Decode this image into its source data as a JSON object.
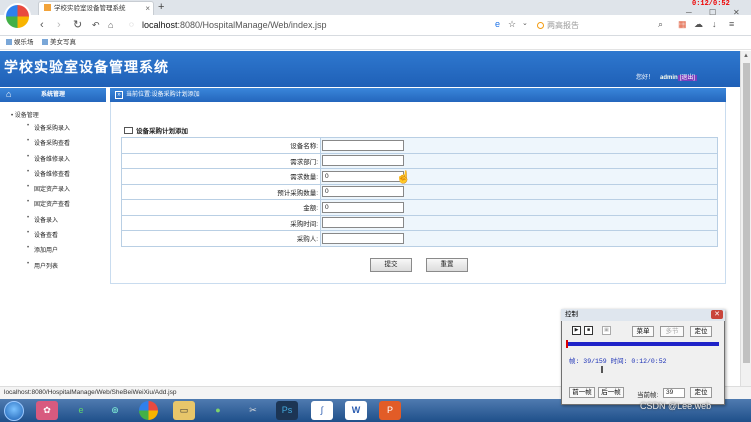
{
  "browser": {
    "tab_title": "学校实验室设备管理系统",
    "tab_close": "×",
    "new_tab": "+",
    "clock": "0:12/0:52",
    "win_min": "─",
    "win_max": "☐",
    "win_close": "✕",
    "url_prefix": "localhost",
    "url_rest": ":8080/HospitalManage/Web/index.jsp",
    "search_placeholder": "两高报告",
    "bookmarks": [
      "娱乐场",
      "美女写真"
    ],
    "status_url": "localhost:8080/HospitalManage/Web/SheBeiWeiXiu/Add.jsp"
  },
  "app": {
    "title": "学校实验室设备管理系统",
    "greeting": "您好！",
    "user": "admin",
    "user_role": "[退出]"
  },
  "sidebar": {
    "header": "系统管理",
    "root": "设备管理",
    "items": [
      {
        "label": "设备采购录入"
      },
      {
        "label": "设备采购查看"
      },
      {
        "label": "设备维修录入"
      },
      {
        "label": "设备维修查看"
      },
      {
        "label": "固定资产录入"
      },
      {
        "label": "固定资产查看"
      },
      {
        "label": "设备录入"
      },
      {
        "label": "设备查看"
      },
      {
        "label": "添加用户"
      },
      {
        "label": "用户列表"
      }
    ]
  },
  "content": {
    "breadcrumb": "当前位置:设备采购计划添加",
    "form_title": "设备采购计划添加",
    "fields": [
      {
        "label": "设备名称:",
        "value": ""
      },
      {
        "label": "需求部门:",
        "value": ""
      },
      {
        "label": "需求数量:",
        "value": "0"
      },
      {
        "label": "预计采购数量:",
        "value": "0"
      },
      {
        "label": "金额:",
        "value": "0"
      },
      {
        "label": "采购时间:",
        "value": ""
      },
      {
        "label": "采购人:",
        "value": ""
      }
    ],
    "submit_label": "提交",
    "reset_label": "重置"
  },
  "control_panel": {
    "title": "控制",
    "menu_label": "菜单",
    "multi_label": "多节",
    "locate_label": "定位",
    "frame_info": "帧: 39/159 时间: 0:12/0:52",
    "prev_frame": "前一帧",
    "next_frame": "后一帧",
    "current_frame_label": "当前帧:",
    "current_frame": "39",
    "locate2_label": "定位"
  },
  "watermark": "CSDN @Lee.web"
}
